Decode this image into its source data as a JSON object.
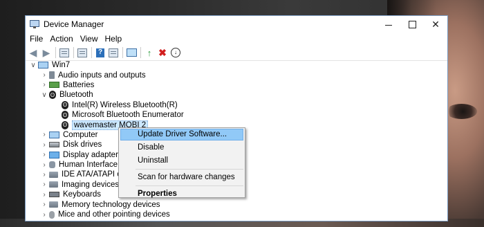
{
  "window": {
    "title": "Device Manager",
    "controls": {
      "minimize": "—",
      "maximize": "",
      "close": "✕"
    }
  },
  "menu": [
    "File",
    "Action",
    "View",
    "Help"
  ],
  "tree": {
    "root": "Win7",
    "categories": [
      {
        "label": "Audio inputs and outputs",
        "icon": "speaker-icon",
        "expanded": false
      },
      {
        "label": "Batteries",
        "icon": "battery-icon",
        "expanded": false
      },
      {
        "label": "Bluetooth",
        "icon": "bluetooth-icon",
        "expanded": true,
        "children": [
          "Intel(R) Wireless Bluetooth(R)",
          "Microsoft Bluetooth Enumerator",
          "wavemaster MOBI 2"
        ]
      },
      {
        "label": "Computer",
        "icon": "computer-icon",
        "expanded": false
      },
      {
        "label": "Disk drives",
        "icon": "disk-icon",
        "expanded": false
      },
      {
        "label": "Display adapters",
        "icon": "display-icon",
        "expanded": false
      },
      {
        "label": "Human Interface De",
        "icon": "hid-icon",
        "expanded": false
      },
      {
        "label": "IDE ATA/ATAPI contr",
        "icon": "ide-icon",
        "expanded": false
      },
      {
        "label": "Imaging devices",
        "icon": "camera-icon",
        "expanded": false
      },
      {
        "label": "Keyboards",
        "icon": "keyboard-icon",
        "expanded": false
      },
      {
        "label": "Memory technology devices",
        "icon": "memory-icon",
        "expanded": false
      },
      {
        "label": "Mice and other pointing devices",
        "icon": "mouse-icon",
        "expanded": false
      }
    ]
  },
  "context_menu": {
    "items": [
      {
        "label": "Update Driver Software...",
        "highlighted": true
      },
      {
        "label": "Disable"
      },
      {
        "label": "Uninstall"
      },
      {
        "label": "Scan for hardware changes"
      },
      {
        "label": "Properties",
        "bold": true
      }
    ]
  }
}
